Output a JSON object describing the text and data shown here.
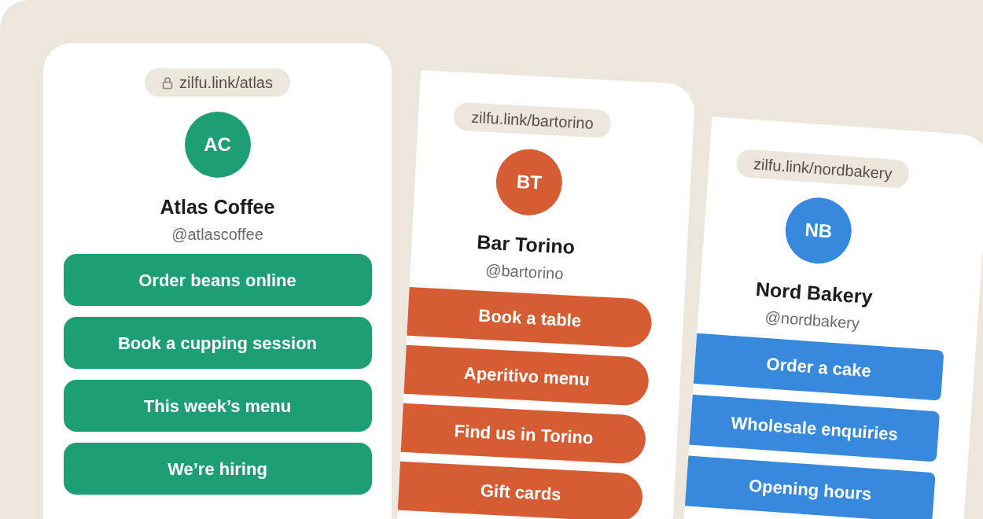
{
  "profiles": [
    {
      "url": "zilfu.link/atlas",
      "lock": true,
      "initials": "AC",
      "name": "Atlas Coffee",
      "handle": "@atlascoffee",
      "color": "#1e9e74",
      "links": [
        "Order beans online",
        "Book a cupping session",
        "This week’s menu",
        "We’re hiring"
      ]
    },
    {
      "url": "zilfu.link/bartorino",
      "lock": false,
      "initials": "BT",
      "name": "Bar Torino",
      "handle": "@bartorino",
      "color": "#d65c33",
      "links": [
        "Book a table",
        "Aperitivo menu",
        "Find us in Torino",
        "Gift cards"
      ]
    },
    {
      "url": "zilfu.link/nordbakery",
      "lock": false,
      "initials": "NB",
      "name": "Nord Bakery",
      "handle": "@nordbakery",
      "color": "#3689dc",
      "links": [
        "Order a cake",
        "Wholesale enquiries",
        "Opening hours"
      ]
    }
  ]
}
